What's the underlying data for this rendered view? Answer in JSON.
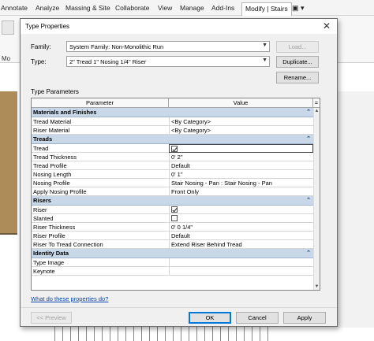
{
  "ribbon": {
    "tabs": [
      "Annotate",
      "Analyze",
      "Massing & Site",
      "Collaborate",
      "View",
      "Manage",
      "Add-Ins",
      "Modify | Stairs"
    ],
    "extra_icon": "layout-icon",
    "left_label": "Mo"
  },
  "dialog": {
    "title": "Type Properties",
    "close_label": "✕",
    "family_label": "Family:",
    "family_value": "System Family: Non-Monolithic Run",
    "type_label": "Type:",
    "type_value": "2\" Tread 1\" Nosing 1/4\" Riser",
    "load_button": "Load...",
    "duplicate_button": "Duplicate...",
    "rename_button": "Rename...",
    "type_parameters_label": "Type Parameters",
    "table": {
      "columns": [
        "Parameter",
        "Value",
        "="
      ],
      "groups": [
        {
          "name": "Materials and Finishes",
          "rows": [
            {
              "param": "Tread Material",
              "value": "<By Category>"
            },
            {
              "param": "Riser Material",
              "value": "<By Category>"
            }
          ]
        },
        {
          "name": "Treads",
          "rows": [
            {
              "param": "Tread",
              "value": "",
              "checkbox": true
            },
            {
              "param": "Tread Thickness",
              "value": "0'  2\""
            },
            {
              "param": "Tread Profile",
              "value": "Default"
            },
            {
              "param": "Nosing Length",
              "value": "0'  1\""
            },
            {
              "param": "Nosing Profile",
              "value": "Stair Nosing - Pan : Stair Nosing - Pan"
            },
            {
              "param": "Apply Nosing Profile",
              "value": "Front Only"
            }
          ]
        },
        {
          "name": "Risers",
          "rows": [
            {
              "param": "Riser",
              "value": "",
              "checkbox": true
            },
            {
              "param": "Slanted",
              "value": "",
              "checkbox": false
            },
            {
              "param": "Riser Thickness",
              "value": "0'  0 1/4\""
            },
            {
              "param": "Riser Profile",
              "value": "Default"
            },
            {
              "param": "Riser To Tread Connection",
              "value": "Extend Riser Behind Tread"
            }
          ]
        },
        {
          "name": "Identity Data",
          "rows": [
            {
              "param": "Type Image",
              "value": ""
            },
            {
              "param": "Keynote",
              "value": ""
            }
          ]
        }
      ]
    },
    "help_link": "What do these properties do?",
    "preview_button": "<< Preview",
    "ok_button": "OK",
    "cancel_button": "Cancel",
    "apply_button": "Apply"
  },
  "colors": {
    "group_header": "#c9d8e9",
    "link": "#0645ad",
    "active_tab": "#ffffff"
  }
}
